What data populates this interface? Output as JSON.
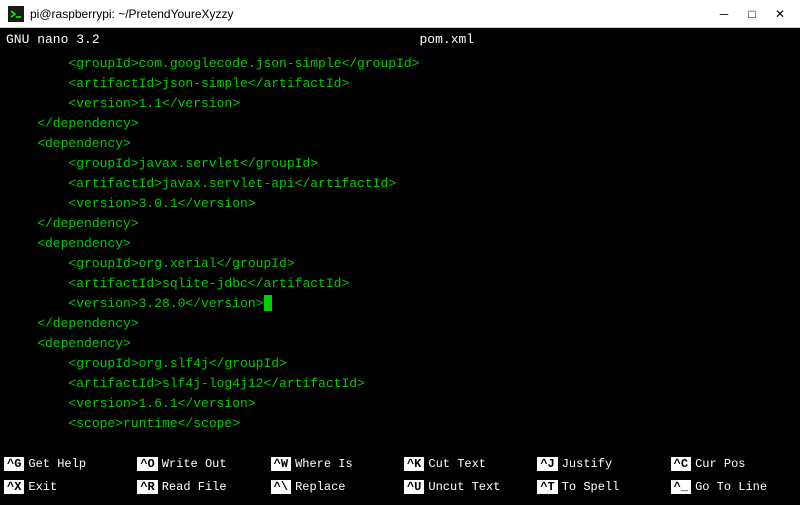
{
  "titlebar": {
    "text": "pi@raspberrypi: ~/PretendYoureXyzzy",
    "minimize": "─",
    "maximize": "□",
    "close": "✕"
  },
  "nano_header": {
    "app": "GNU nano 3.2",
    "filename": "pom.xml"
  },
  "editor_lines": [
    "        <groupId>com.googlecode.json-simple</groupId>",
    "        <artifactId>json-simple</artifactId>",
    "        <version>1.1</version>",
    "    </dependency>",
    "    <dependency>",
    "        <groupId>javax.servlet</groupId>",
    "        <artifactId>javax.servlet-api</artifactId>",
    "        <version>3.0.1</version>",
    "    </dependency>",
    "    <dependency>",
    "        <groupId>org.xerial</groupId>",
    "        <artifactId>sqlite-jdbc</artifactId>",
    "        <version>3.28.0</version>",
    "    </dependency>",
    "    <dependency>",
    "        <groupId>org.slf4j</groupId>",
    "        <artifactId>slf4j-log4j12</artifactId>",
    "        <version>1.6.1</version>",
    "        <scope>runtime</scope>"
  ],
  "cursor_line": 12,
  "cursor_after": "        <version>3.28.0</version>",
  "footer": {
    "shortcuts": [
      {
        "key": "^G",
        "label": "Get Help"
      },
      {
        "key": "^O",
        "label": "Write Out"
      },
      {
        "key": "^W",
        "label": "Where Is"
      },
      {
        "key": "^K",
        "label": "Cut Text"
      },
      {
        "key": "^J",
        "label": "Justify"
      },
      {
        "key": "^C",
        "label": "Cur Pos"
      },
      {
        "key": "^X",
        "label": "Exit"
      },
      {
        "key": "^R",
        "label": "Read File"
      },
      {
        "key": "^\\",
        "label": "Replace"
      },
      {
        "key": "^U",
        "label": "Uncut Text"
      },
      {
        "key": "^T",
        "label": "To Spell"
      },
      {
        "key": "^_",
        "label": "Go To Line"
      }
    ]
  }
}
